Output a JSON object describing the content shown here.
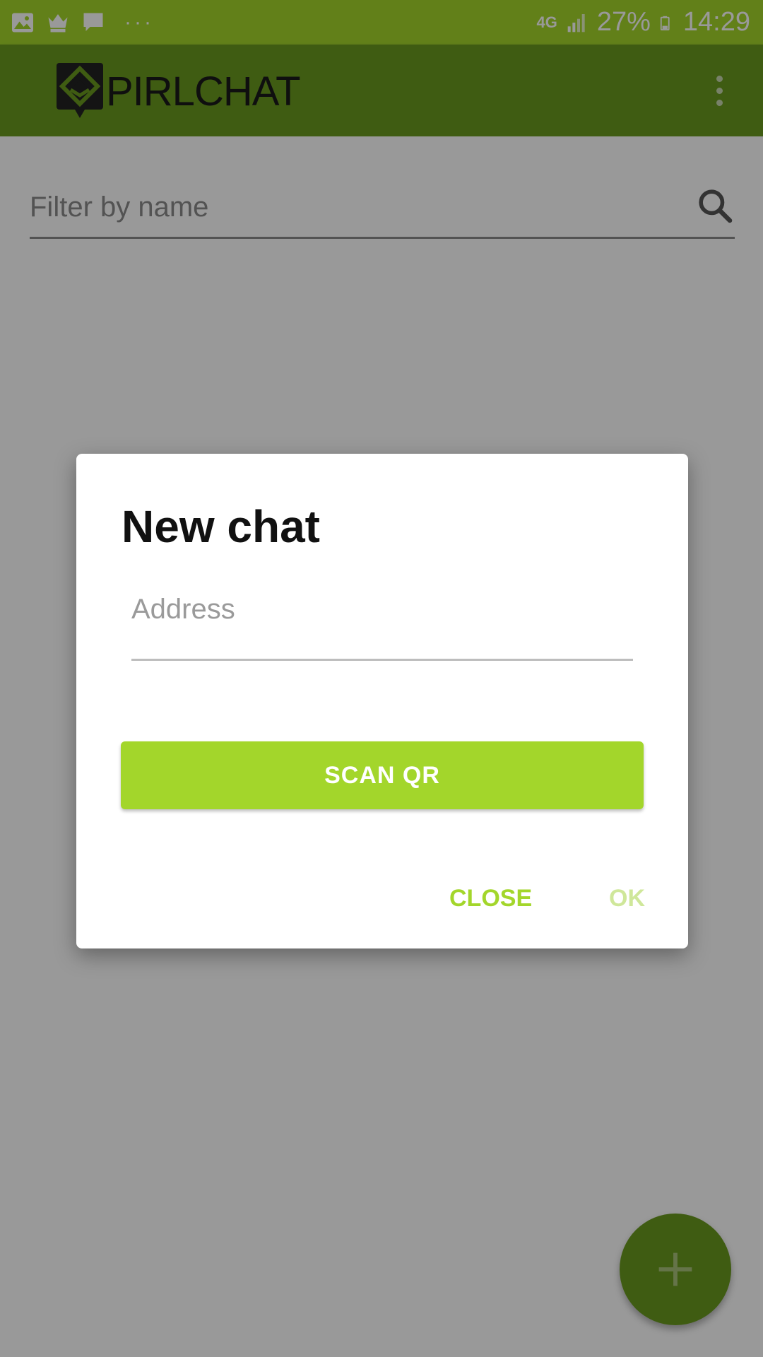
{
  "status_bar": {
    "network": "4G",
    "battery": "27%",
    "time": "14:29",
    "left_icons": [
      "image-icon",
      "crown-icon",
      "message-icon",
      "more-dots-icon"
    ]
  },
  "app_bar": {
    "logo_text": "PIRLCHAT",
    "menu_icon": "overflow-menu-icon"
  },
  "filter": {
    "placeholder": "Filter by name",
    "icon": "search-icon"
  },
  "dialog": {
    "title": "New chat",
    "address_placeholder": "Address",
    "scan_label": "SCAN QR",
    "close_label": "CLOSE",
    "ok_label": "OK"
  },
  "fab": {
    "icon": "plus-icon"
  },
  "colors": {
    "accent": "#a3d62b",
    "primary_dark": "#6a9a1e",
    "ok_disabled": "#cfe79a"
  }
}
